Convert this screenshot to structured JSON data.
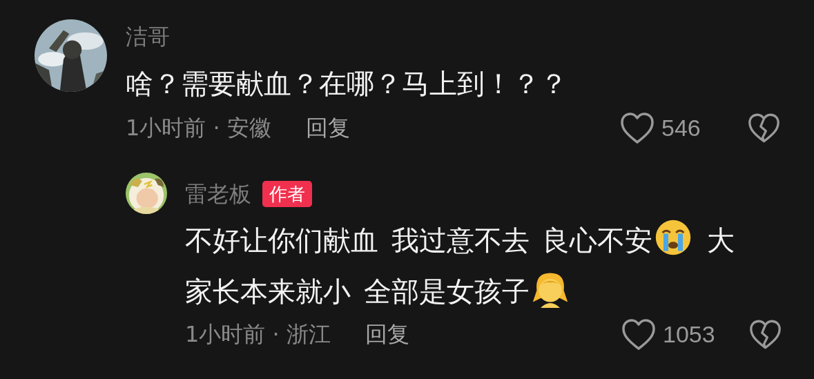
{
  "comment": {
    "author": "洁哥",
    "body": [
      {
        "kind": "text",
        "text": "啥？需要献血？在哪？马上到！？？"
      }
    ],
    "time": "1小时前 · 安徽",
    "reply_label": "回复",
    "likes": "546",
    "liked": false,
    "disliked": false,
    "replies": [
      {
        "author": "雷老板",
        "badge": "作者",
        "body": [
          {
            "kind": "text",
            "text": "不好让你们献血 我过意不去 良心不安"
          },
          {
            "kind": "cry"
          },
          {
            "kind": "text",
            "text": " 大"
          },
          {
            "kind": "break"
          },
          {
            "kind": "text",
            "text": "家长本来就小 全部是女孩子"
          },
          {
            "kind": "girl"
          }
        ],
        "time": "1小时前 · 浙江",
        "reply_label": "回复",
        "likes": "1053",
        "liked": false,
        "disliked": false
      }
    ]
  }
}
